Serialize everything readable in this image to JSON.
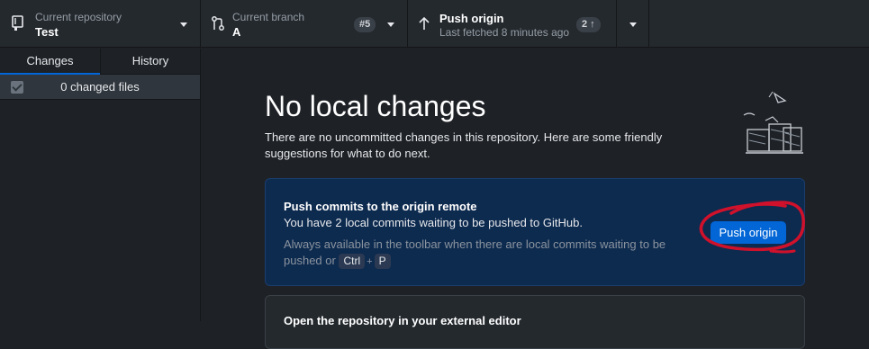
{
  "toolbar": {
    "repository": {
      "label": "Current repository",
      "value": "Test"
    },
    "branch": {
      "label": "Current branch",
      "value": "A",
      "pr_badge": "#5"
    },
    "push": {
      "title": "Push origin",
      "subtitle": "Last fetched 8 minutes ago",
      "count_badge": "2 ↑"
    }
  },
  "sidebar": {
    "tabs": [
      {
        "label": "Changes",
        "active": true
      },
      {
        "label": "History",
        "active": false
      }
    ],
    "changed_files": "0 changed files"
  },
  "main": {
    "heading": "No local changes",
    "description": "There are no uncommitted changes in this repository. Here are some friendly suggestions for what to do next.",
    "push_card": {
      "title": "Push commits to the origin remote",
      "description": "You have 2 local commits waiting to be pushed to GitHub.",
      "hint": "Always available in the toolbar when there are local commits waiting to be pushed or",
      "shortcut_key1": "Ctrl",
      "shortcut_plus": "+",
      "shortcut_key2": "P",
      "button_label": "Push origin"
    },
    "editor_card": {
      "title": "Open the repository in your external editor"
    }
  },
  "colors": {
    "accent": "#0366d6",
    "annotation": "#d0112b",
    "card_bg": "#0d2a4f"
  },
  "icons": [
    "repo-icon",
    "branch-icon",
    "arrow-up-icon",
    "chevron-down-icon",
    "checkbox-checked-icon"
  ]
}
